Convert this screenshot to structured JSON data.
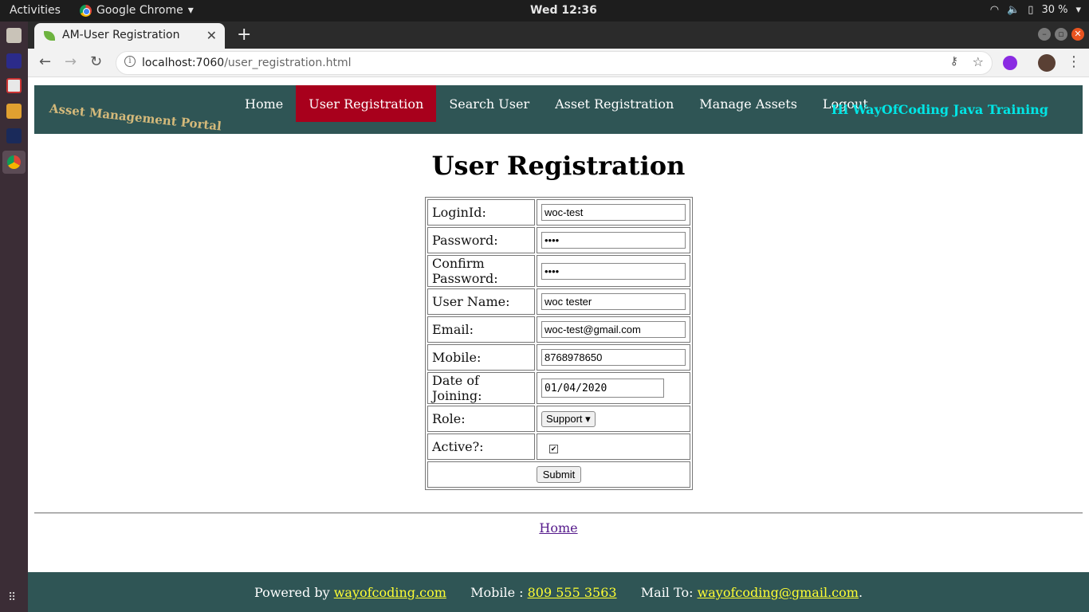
{
  "os": {
    "activities": "Activities",
    "app_name": "Google Chrome",
    "clock": "Wed 12:36",
    "battery": "30 %"
  },
  "browser": {
    "tab_title": "AM-User Registration",
    "url_host": "localhost:7060",
    "url_path": "/user_registration.html"
  },
  "site": {
    "brand": "Asset Management Portal",
    "nav": [
      {
        "label": "Home"
      },
      {
        "label": "User Registration"
      },
      {
        "label": "Search User"
      },
      {
        "label": "Asset Registration"
      },
      {
        "label": "Manage Assets"
      },
      {
        "label": "Logout"
      }
    ],
    "active_nav": "User Registration",
    "greeting": "Hi WayOfCoding Java Training"
  },
  "form": {
    "heading": "User Registration",
    "fields": {
      "loginid": {
        "label": "LoginId:",
        "value": "woc-test"
      },
      "password": {
        "label": "Password:",
        "value": "••••"
      },
      "confirm_password": {
        "label": "Confirm Password:",
        "value": "••••"
      },
      "user_name": {
        "label": "User Name:",
        "value": "woc tester"
      },
      "email": {
        "label": "Email:",
        "value": "woc-test@gmail.com"
      },
      "mobile": {
        "label": "Mobile:",
        "value": "8768978650"
      },
      "doj": {
        "label": "Date of Joining:",
        "value": "01/04/2020"
      },
      "role": {
        "label": "Role:",
        "value": "Support"
      },
      "active": {
        "label": "Active?:",
        "checked": true
      }
    },
    "submit_label": "Submit"
  },
  "footer": {
    "home_link": "Home",
    "powered_by": "Powered by",
    "powered_link": "wayofcoding.com",
    "mobile_label": "Mobile :",
    "mobile_value": "809 555 3563",
    "mail_label": "Mail To:",
    "mail_value": "wayofcoding@gmail.com",
    "mail_suffix": "."
  },
  "colors": {
    "header_bg": "#2f5555",
    "active_nav": "#a8001c",
    "brand": "#d4b97a",
    "greeting": "#00e5e5",
    "footer_link": "#ffff33"
  }
}
